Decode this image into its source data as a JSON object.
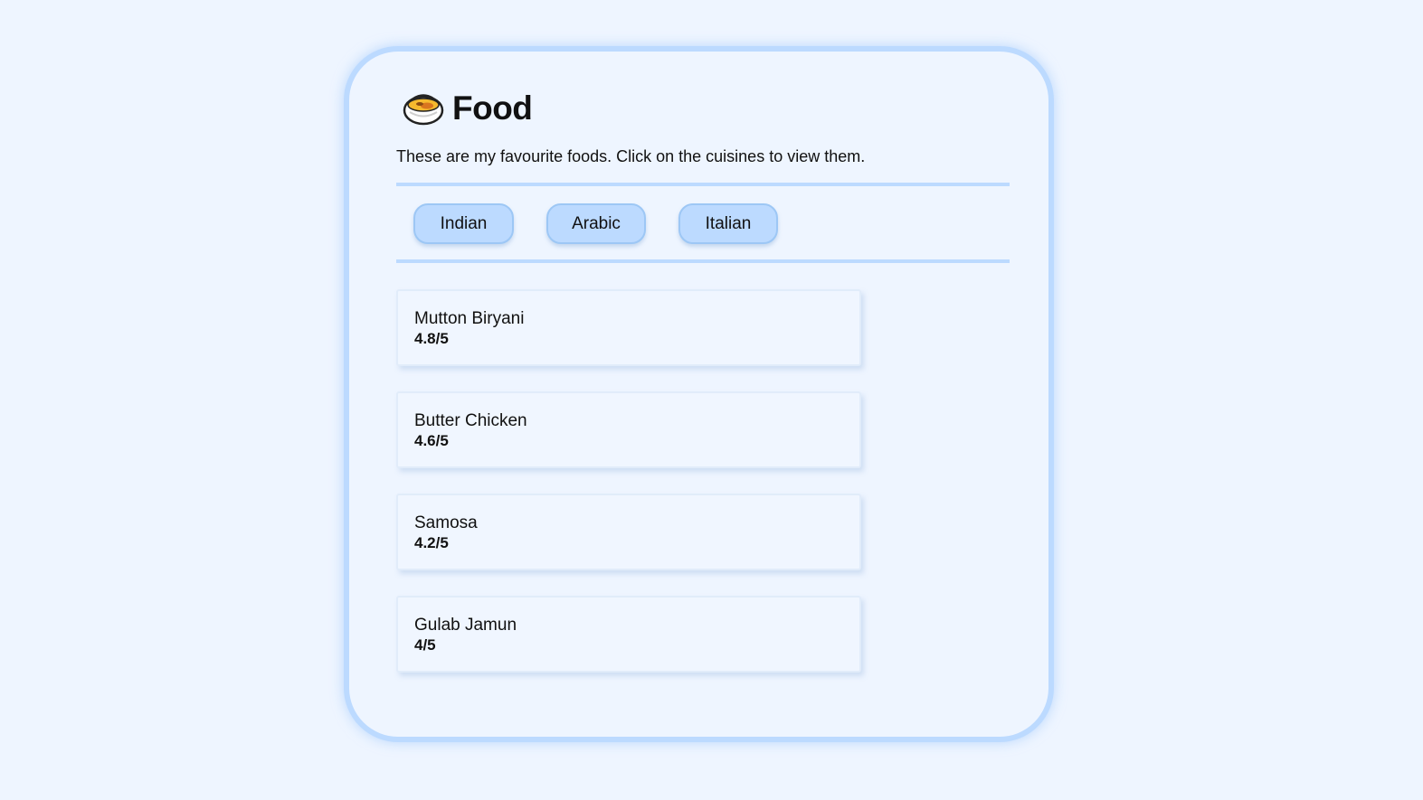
{
  "header": {
    "icon": "curry-bowl-icon",
    "title": "Food"
  },
  "subtitle": "These are my favourite foods. Click on the cuisines to view them.",
  "tabs": [
    {
      "label": "Indian"
    },
    {
      "label": "Arabic"
    },
    {
      "label": "Italian"
    }
  ],
  "foods": [
    {
      "name": "Mutton Biryani",
      "rating": "4.8/5"
    },
    {
      "name": "Butter Chicken",
      "rating": "4.6/5"
    },
    {
      "name": "Samosa",
      "rating": "4.2/5"
    },
    {
      "name": "Gulab Jamun",
      "rating": "4/5"
    }
  ],
  "colors": {
    "background": "#eef5ff",
    "accent": "#bcdaff",
    "tab_border": "#9dc7f5"
  }
}
